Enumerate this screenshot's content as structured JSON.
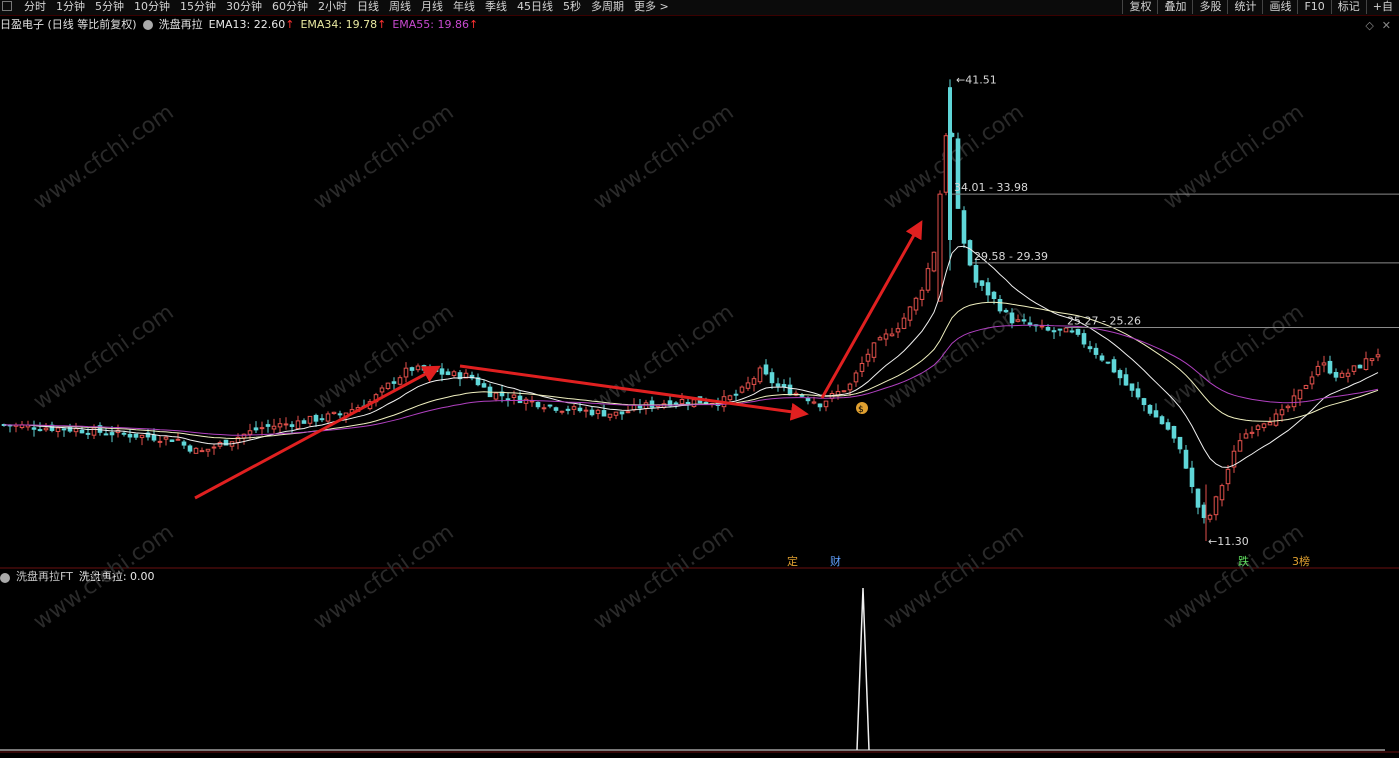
{
  "toolbar": {
    "period_tabs": [
      "分时",
      "1分钟",
      "5分钟",
      "10分钟",
      "15分钟",
      "30分钟",
      "60分钟",
      "2小时",
      "日线",
      "周线",
      "月线",
      "年线",
      "季线",
      "45日线",
      "5秒",
      "多周期",
      "更多 >"
    ],
    "tool_buttons": [
      "复权",
      "叠加",
      "多股",
      "统计",
      "画线",
      "F10",
      "标记",
      "+自"
    ]
  },
  "main_panel": {
    "stock_title": "日盈电子 (日线 等比前复权)",
    "indicator_name": "洗盘再拉",
    "ema13_label": "EMA13: 22.60",
    "ema34_label": "EMA34: 19.78",
    "ema55_label": "EMA55: 19.86",
    "up_arrow": "↑"
  },
  "sub_panel": {
    "indicator_title": "洗盘再拉FT",
    "value_label": "洗盘再拉: 0.00"
  },
  "markers": {
    "ding": "定",
    "cai": "财",
    "die": "跌",
    "bang": "3榜",
    "money_icon": "$"
  },
  "watermark": "www.cfchi.com",
  "colors": {
    "up": "#e2504b",
    "down": "#5fd6d8",
    "ema13": "#f0f0f0",
    "ema34": "#f0f0c0",
    "ema55": "#b040c0",
    "arrow": "#e02020",
    "level_line": "#8a8a8a",
    "panel_border": "#6a1010"
  },
  "chart_data": {
    "type": "candlestick",
    "price_annotations": [
      {
        "label": "41.51",
        "value": 41.51
      },
      {
        "label": "34.01 - 33.98",
        "value": 34.0
      },
      {
        "label": "29.58 - 29.39",
        "value": 29.5
      },
      {
        "label": "25.27 - 25.26",
        "value": 25.27
      },
      {
        "label": "11.30",
        "value": 11.3
      }
    ],
    "series": [
      {
        "name": "EMA13",
        "color": "#f0f0f0"
      },
      {
        "name": "EMA34",
        "color": "#f0f0c0"
      },
      {
        "name": "EMA55",
        "color": "#b040c0"
      }
    ],
    "sub_signal": {
      "name": "洗盘再拉",
      "current_value": 0.0,
      "peak_value": 1.0
    }
  }
}
